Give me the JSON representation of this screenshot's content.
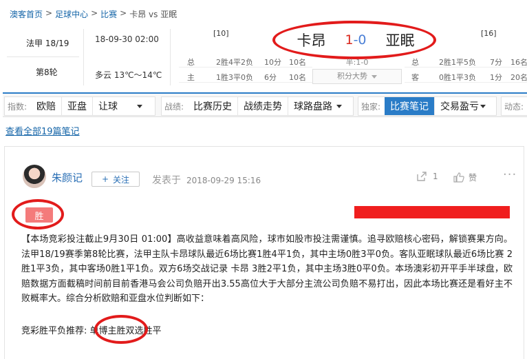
{
  "breadcrumb": {
    "items": [
      "澳客首页",
      "足球中心",
      "比赛"
    ],
    "sep": ">",
    "current": "卡昂 vs 亚眠"
  },
  "match": {
    "league": "法甲 18/19",
    "round": "第8轮",
    "datetime": "18-09-30 02:00",
    "weather": "多云  13℃～14℃",
    "home_rank": "[10]",
    "away_rank": "[16]",
    "home": "卡昂",
    "away": "亚眠",
    "home_score": "1",
    "score_sep": "-",
    "away_score": "0",
    "home_stats": [
      {
        "label": "总",
        "record": "2胜4平2负",
        "goals": "10分",
        "pos": "10名"
      },
      {
        "label": "主",
        "record": "1胜3平0负",
        "goals": "6分",
        "pos": "10名"
      }
    ],
    "away_stats": [
      {
        "label": "总",
        "record": "2胜1平5负",
        "goals": "7分",
        "pos": "16名"
      },
      {
        "label": "客",
        "record": "0胜1平3负",
        "goals": "1分",
        "pos": "20名"
      }
    ],
    "half_score": "半:1-0",
    "points_trend": "积分大势"
  },
  "nav": {
    "index_label": "指数:",
    "index_items": [
      "欧赔",
      "亚盘",
      "让球"
    ],
    "record_label": "战绩:",
    "record_items": [
      "比赛历史",
      "战绩走势",
      "球路盘路"
    ],
    "exclusive_label": "独家:",
    "exclusive_items": [
      "比赛笔记",
      "交易盈亏"
    ],
    "dynamic_label": "动态:"
  },
  "all_notes_link": "查看全部19篇笔记",
  "note": {
    "author": "朱颜记",
    "follow": "关注",
    "follow_plus": "+",
    "posted_label": "发表于",
    "posted_time": "2018-09-29 15:16",
    "share_count": "1",
    "like_label": "赞",
    "more": "···",
    "result_badge": "胜",
    "body": "【本场竞彩投注截止9月30日 01:00】高收益意味着高风险，球市如股市投注需谨慎。追寻欧赔核心密码，解锁赛果方向。法甲18/19赛季第8轮比赛，法甲主队卡昂球队最近6场比赛1胜4平1负，其中主场0胜3平0负。客队亚眠球队最近6场比赛 2胜1平3负，其中客场0胜1平1负。双方6场交战记录 卡昂 3胜2平1负，其中主场3胜0平0负。本场澳彩初开平手半球盘，欧赔数据方面截稿时间前目前香港马会公司负赔开出3.55高位大于大部分主流公司负赔不易打出，因此本场比赛还是看好主不败概率大。综合分析欧赔和亚盘水位判断如下：",
    "rec_label": "竞彩胜平负推荐:",
    "rec_pick": "单博主胜",
    "rec_alt": "双选胜平"
  },
  "colors": {
    "link": "#1565a8",
    "accent": "#2a7cc7",
    "highlight_ellipse": "#e21b1b",
    "win_badge": "#f47b7b",
    "home_score": "#d9281e",
    "away_score": "#4a7fd6"
  }
}
